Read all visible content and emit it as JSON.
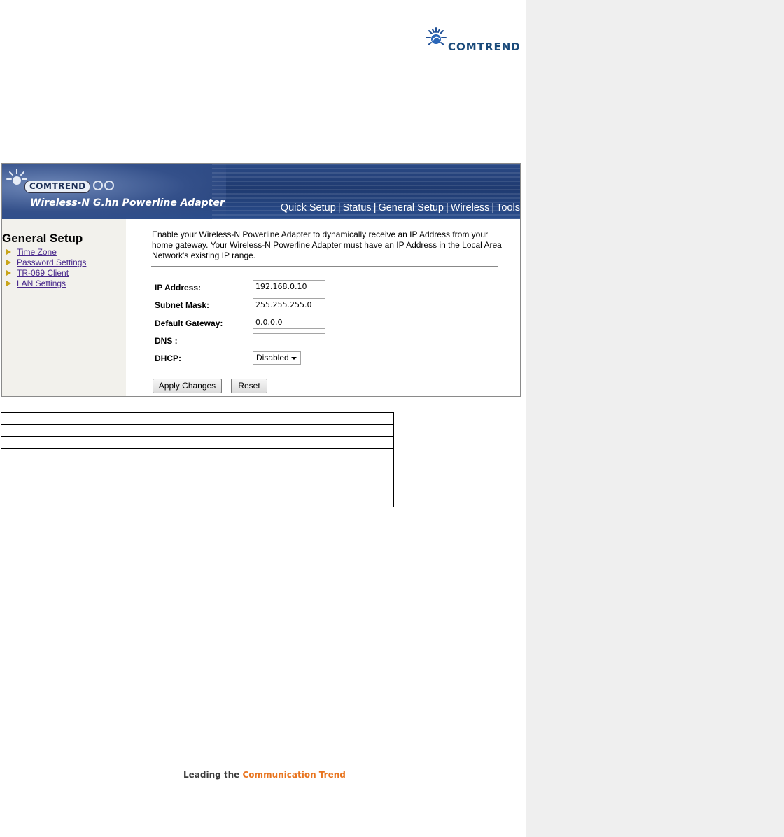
{
  "doc": {
    "brand_logo_text": "COMTREND",
    "tagline": {
      "part1": "Leading the ",
      "part2_highlight": "Com",
      "part3": "munication ",
      "part4_highlight": "Trend"
    }
  },
  "screenshot": {
    "banner": {
      "logo_text": "COMTREND",
      "product_name": "Wireless-N G.hn Powerline Adapter",
      "nav": [
        "Quick Setup",
        "Status",
        "General Setup",
        "Wireless",
        "Tools"
      ],
      "nav_separator": "|"
    },
    "sidebar": {
      "title": "General Setup",
      "items": [
        "Time Zone",
        "Password Settings",
        "TR-069 Client",
        "LAN Settings"
      ]
    },
    "content": {
      "description": "Enable your Wireless-N Powerline Adapter to dynamically receive an IP Address from your home gateway. Your Wireless-N Powerline Adapter must have an IP Address in the Local Area Network's existing IP range.",
      "fields": {
        "ip_address": {
          "label": "IP Address:",
          "value": "192.168.0.10"
        },
        "subnet_mask": {
          "label": "Subnet Mask:",
          "value": "255.255.255.0"
        },
        "default_gateway": {
          "label": "Default Gateway:",
          "value": "0.0.0.0"
        },
        "dns": {
          "label": "DNS :",
          "value": ""
        },
        "dhcp": {
          "label": "DHCP:",
          "value": "Disabled"
        }
      },
      "buttons": {
        "apply": "Apply Changes",
        "reset": "Reset"
      }
    }
  },
  "colors": {
    "banner": "#2b4a86",
    "sidebar_bg": "#f2f1ec",
    "link": "#4a2a8c",
    "arrow": "#c9a51a",
    "tagline_accent": "#e8741e",
    "margin_bg": "#efefef"
  }
}
